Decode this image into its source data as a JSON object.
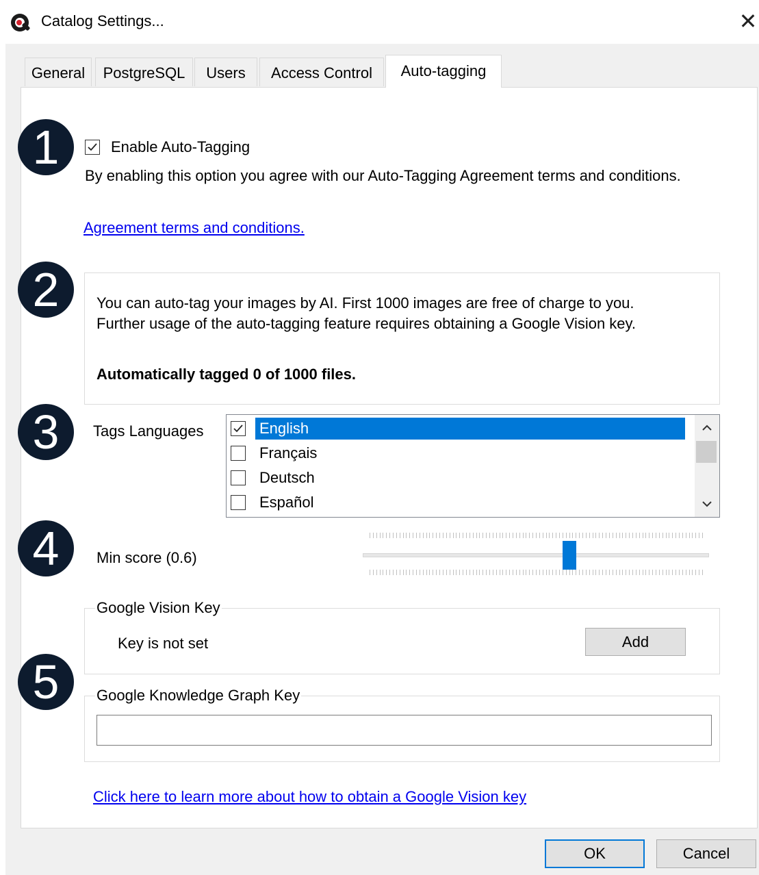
{
  "window": {
    "title": "Catalog Settings...",
    "close_glyph": "✕"
  },
  "tabs": [
    {
      "label": "General",
      "active": false
    },
    {
      "label": "PostgreSQL",
      "active": false
    },
    {
      "label": "Users",
      "active": false
    },
    {
      "label": "Access Control",
      "active": false
    },
    {
      "label": "Auto-tagging",
      "active": true
    }
  ],
  "badges": [
    "1",
    "2",
    "3",
    "4",
    "5"
  ],
  "auto_tagging": {
    "enable_label": "Enable Auto-Tagging",
    "enable_checked": true,
    "agreement_text": "By enabling this option you agree with our Auto-Tagging Agreement terms and conditions.",
    "agreement_link": " Agreement terms and conditions."
  },
  "info_box": {
    "line1": "You can auto-tag your images by AI. First 1000 images are free of charge to you.",
    "line2": "Further usage of the auto-tagging feature requires obtaining a Google Vision key.",
    "status": "Automatically tagged 0 of 1000 files."
  },
  "languages": {
    "label": "Tags Languages",
    "items": [
      {
        "label": "English",
        "checked": true,
        "selected": true
      },
      {
        "label": "Français",
        "checked": false,
        "selected": false
      },
      {
        "label": "Deutsch",
        "checked": false,
        "selected": false
      },
      {
        "label": "Español",
        "checked": false,
        "selected": false
      }
    ],
    "scroll_up_glyph": "⌃",
    "scroll_down_glyph": "⌄"
  },
  "min_score": {
    "label": "Min score (0.6)",
    "value": 0.6
  },
  "vision_key": {
    "group_title": "Google Vision Key",
    "status": "Key is not set",
    "add_label": "Add"
  },
  "knowledge_key": {
    "group_title": "Google Knowledge Graph Key",
    "value": "",
    "placeholder": ""
  },
  "learn_more_link": "Click here to learn more about how to obtain a Google Vision key",
  "footer": {
    "ok_label": "OK",
    "cancel_label": "Cancel"
  },
  "colors": {
    "badge": "#0d1b2e",
    "accent": "#0078d7",
    "link": "#0000ee"
  }
}
